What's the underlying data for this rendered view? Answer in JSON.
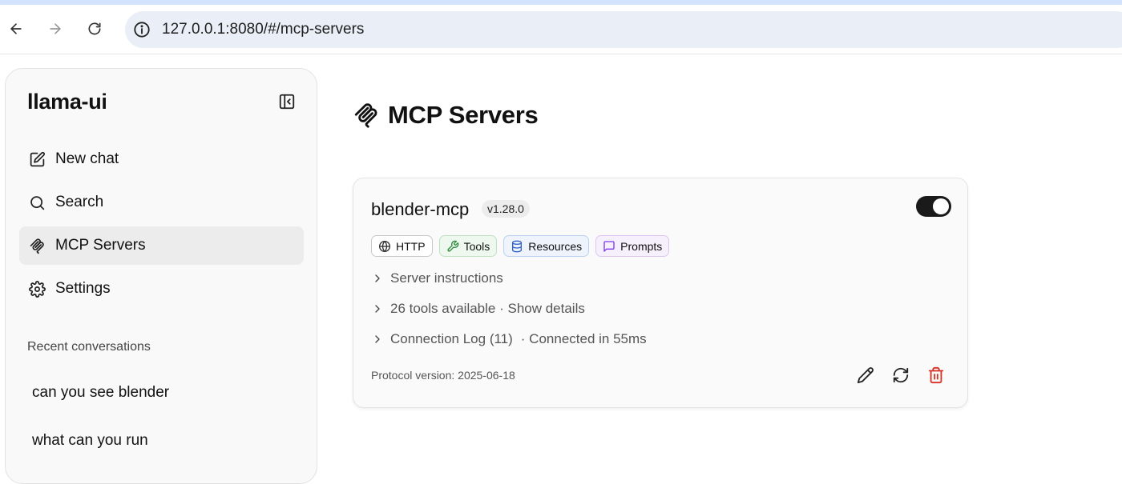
{
  "browser": {
    "url": "127.0.0.1:8080/#/mcp-servers"
  },
  "sidebar": {
    "brand": "llama-ui",
    "items": [
      {
        "label": "New chat",
        "icon": "edit-icon"
      },
      {
        "label": "Search",
        "icon": "search-icon"
      },
      {
        "label": "MCP Servers",
        "icon": "mcp-icon",
        "active": true
      },
      {
        "label": "Settings",
        "icon": "gear-icon"
      }
    ],
    "recent_title": "Recent conversations",
    "conversations": [
      {
        "title": "can you see blender"
      },
      {
        "title": "what can you run"
      }
    ]
  },
  "main": {
    "title": "MCP Servers",
    "server": {
      "name": "blender-mcp",
      "version": "v1.28.0",
      "enabled": true,
      "badges": [
        {
          "label": "HTTP",
          "icon": "globe-icon",
          "color": "#333333"
        },
        {
          "label": "Tools",
          "icon": "wrench-icon",
          "color": "#2e8b3e"
        },
        {
          "label": "Resources",
          "icon": "database-icon",
          "color": "#2f62c9"
        },
        {
          "label": "Prompts",
          "icon": "message-icon",
          "color": "#7c3aed"
        }
      ],
      "rows": [
        {
          "label": "Server instructions",
          "extra": ""
        },
        {
          "label": "26 tools available · Show details",
          "extra": ""
        },
        {
          "label": "Connection Log (11)",
          "extra": "· Connected in 55ms"
        }
      ],
      "protocol": "Protocol version: 2025-06-18",
      "actions": [
        {
          "icon": "pencil-icon"
        },
        {
          "icon": "refresh-icon"
        },
        {
          "icon": "trash-icon",
          "color": "#d93025"
        }
      ]
    }
  }
}
